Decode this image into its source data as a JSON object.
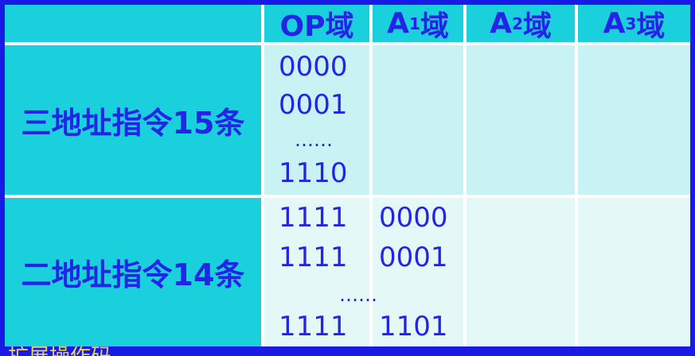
{
  "header": {
    "corner": "",
    "op": "OP域",
    "a1_main": "A",
    "a1_sub": "1",
    "a1_suffix": "域",
    "a2_main": "A",
    "a2_sub": "2",
    "a2_suffix": "域",
    "a3_main": "A",
    "a3_sub": "3",
    "a3_suffix": "域"
  },
  "rows": [
    {
      "label": "三地址指令15条",
      "op_lines": [
        "0000",
        "0001",
        "……",
        "1110"
      ]
    },
    {
      "label": "二地址指令14条",
      "op_lines": [
        "1111",
        "1111",
        "1111"
      ],
      "a1_lines": [
        "0000",
        "0001",
        "1101"
      ],
      "ellipsis": "……"
    }
  ],
  "footer_text": "扩展操作码"
}
